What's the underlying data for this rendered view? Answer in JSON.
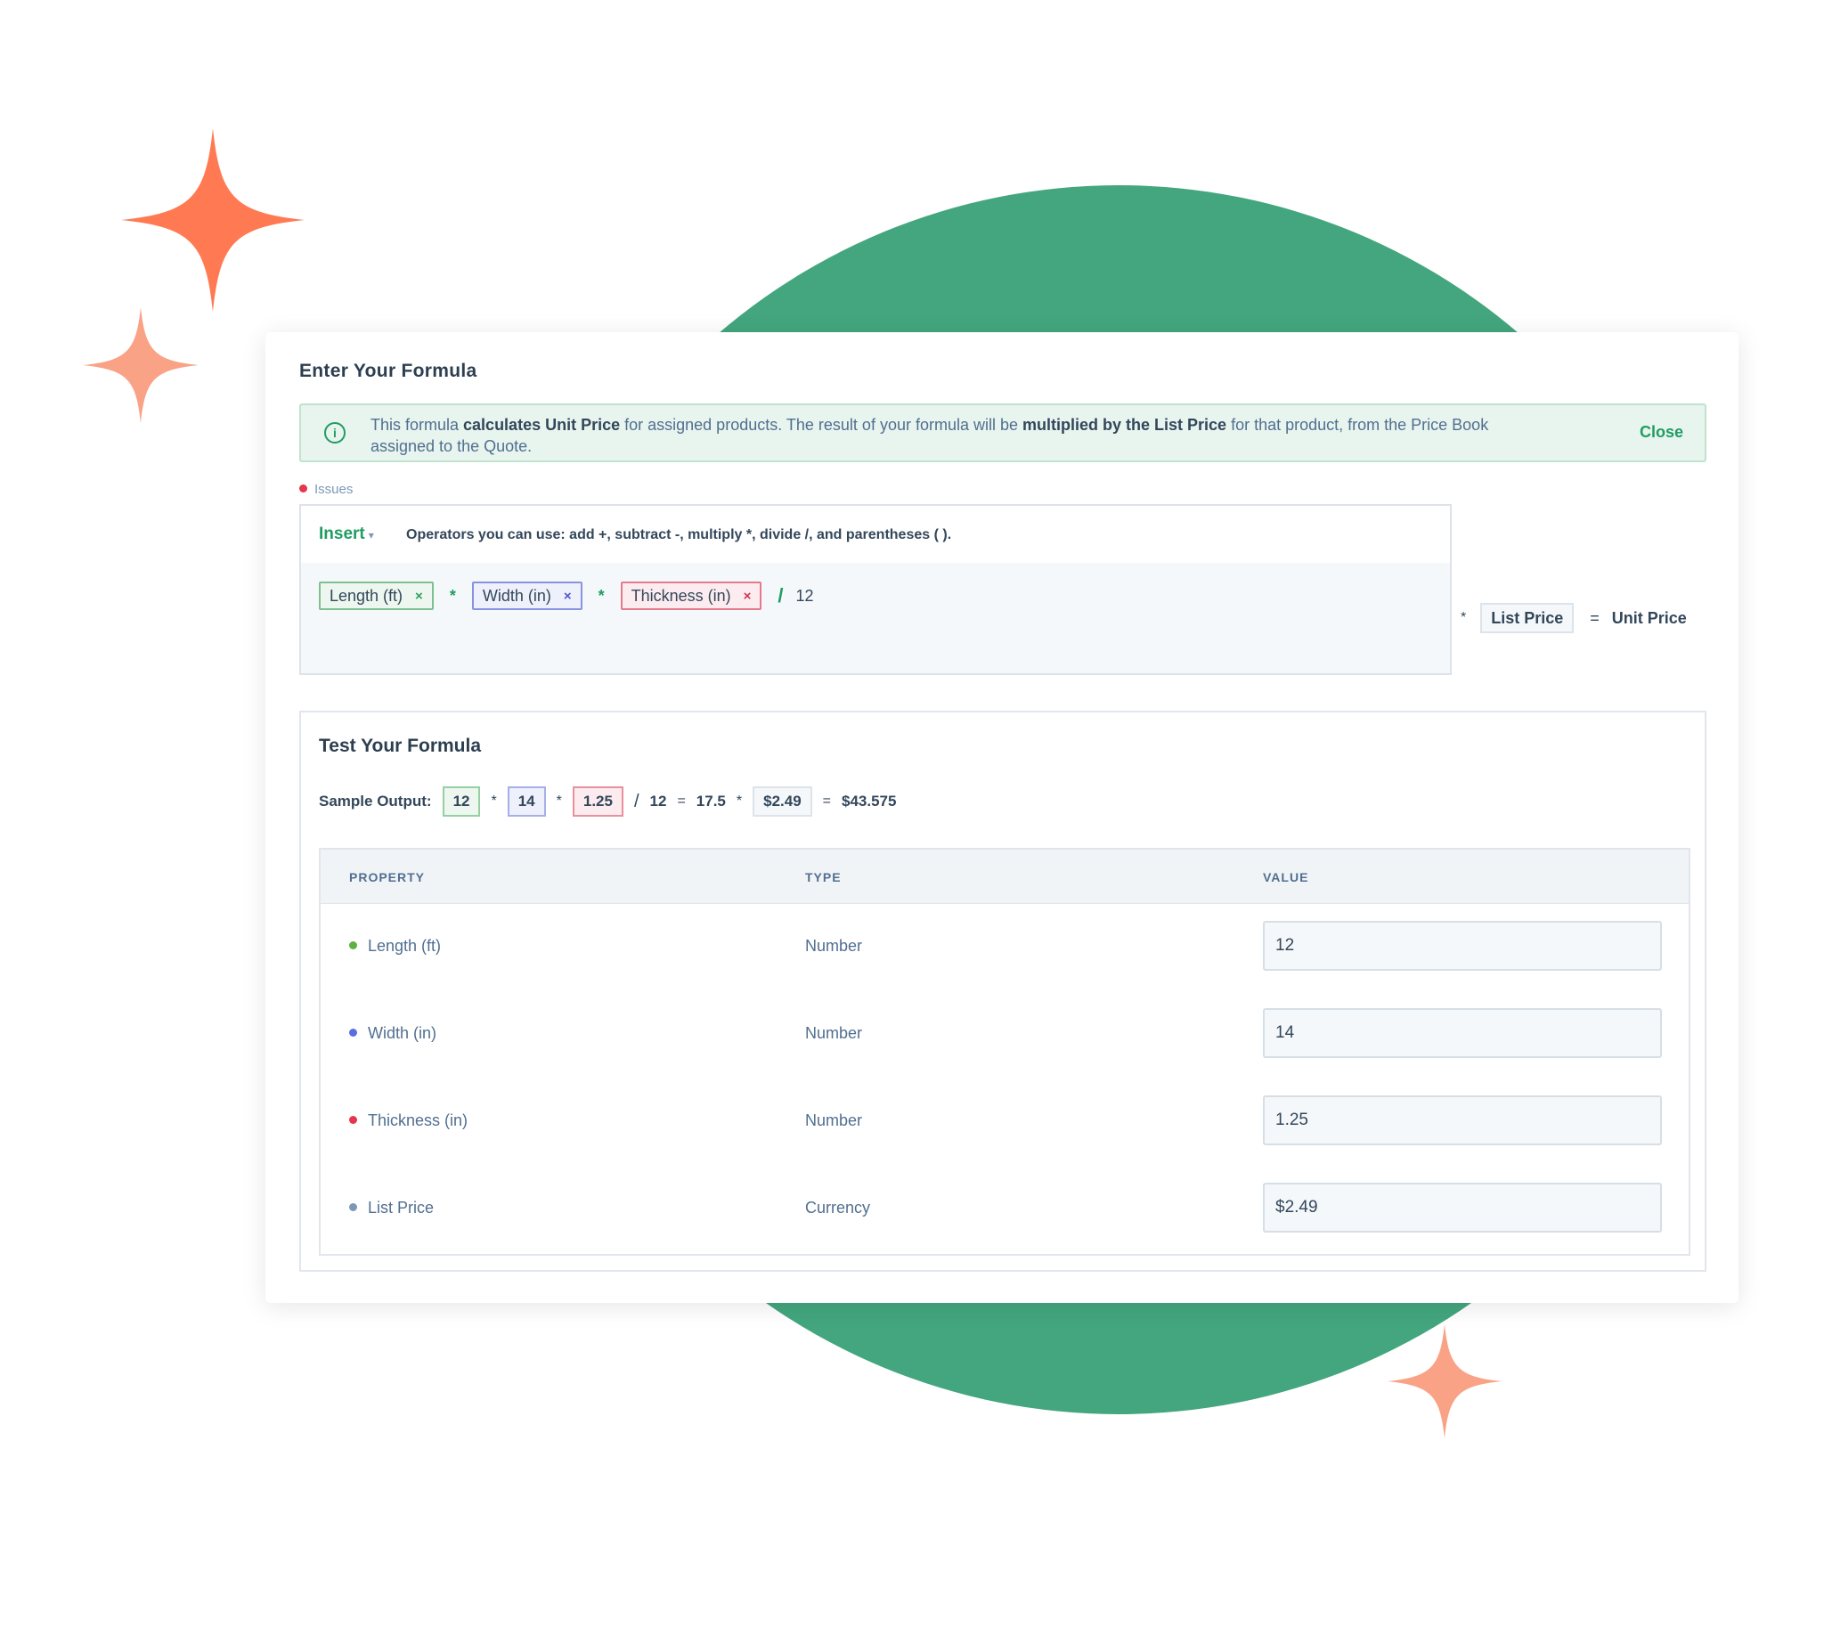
{
  "panel": {
    "title": "Enter Your Formula",
    "info": {
      "part1": "This formula ",
      "bold1": "calculates Unit Price",
      "part2": " for assigned products. The result of your formula will be ",
      "bold2": "multiplied by the List Price",
      "part3": " for that product, from the Price Book assigned to the Quote.",
      "close_label": "Close"
    },
    "issues_label": "Issues"
  },
  "editor": {
    "insert_label": "Insert",
    "operators_hint": "Operators you can use: add +, subtract -, multiply *, divide /, and parentheses ( ).",
    "tokens": [
      {
        "label": "Length (ft)",
        "remove": "×"
      },
      {
        "label": "Width (in)",
        "remove": "×"
      },
      {
        "label": "Thickness (in)",
        "remove": "×"
      }
    ],
    "operators": [
      "*",
      "*",
      "/"
    ],
    "constant": "12"
  },
  "result": {
    "multiply": "*",
    "list_price": "List Price",
    "equals": "=",
    "unit_price": "Unit Price"
  },
  "test": {
    "title": "Test Your Formula",
    "sample_label": "Sample Output:",
    "values": [
      "12",
      "14",
      "1.25"
    ],
    "multiply": "*",
    "divide": "/",
    "divisor": "12",
    "equals": "=",
    "intermediate": "17.5",
    "list_price": "$2.49",
    "result": "$43.575"
  },
  "table": {
    "headers": [
      "PROPERTY",
      "TYPE",
      "VALUE"
    ],
    "rows": [
      {
        "property": "Length (ft)",
        "type": "Number",
        "value": "12",
        "dot_color": "#5fb040"
      },
      {
        "property": "Width (in)",
        "type": "Number",
        "value": "14",
        "dot_color": "#5b6ee1"
      },
      {
        "property": "Thickness (in)",
        "type": "Number",
        "value": "1.25",
        "dot_color": "#e5364c"
      },
      {
        "property": "List Price",
        "type": "Currency",
        "value": "$2.49",
        "dot_color": "#7c98b6"
      }
    ]
  },
  "colors": {
    "circle": "#43a67e",
    "sparkle_dark": "#ff7a52",
    "sparkle_light": "#f9a286",
    "accent_green": "#1f9d62"
  }
}
